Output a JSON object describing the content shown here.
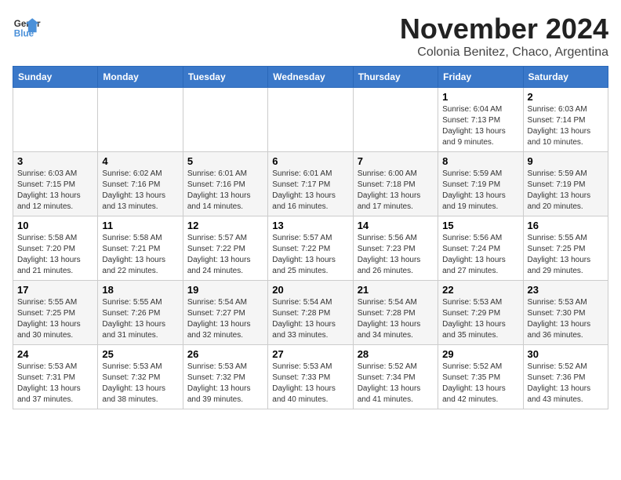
{
  "logo": {
    "line1": "General",
    "line2": "Blue"
  },
  "title": "November 2024",
  "location": "Colonia Benitez, Chaco, Argentina",
  "weekdays": [
    "Sunday",
    "Monday",
    "Tuesday",
    "Wednesday",
    "Thursday",
    "Friday",
    "Saturday"
  ],
  "weeks": [
    [
      {
        "day": "",
        "info": ""
      },
      {
        "day": "",
        "info": ""
      },
      {
        "day": "",
        "info": ""
      },
      {
        "day": "",
        "info": ""
      },
      {
        "day": "",
        "info": ""
      },
      {
        "day": "1",
        "info": "Sunrise: 6:04 AM\nSunset: 7:13 PM\nDaylight: 13 hours\nand 9 minutes."
      },
      {
        "day": "2",
        "info": "Sunrise: 6:03 AM\nSunset: 7:14 PM\nDaylight: 13 hours\nand 10 minutes."
      }
    ],
    [
      {
        "day": "3",
        "info": "Sunrise: 6:03 AM\nSunset: 7:15 PM\nDaylight: 13 hours\nand 12 minutes."
      },
      {
        "day": "4",
        "info": "Sunrise: 6:02 AM\nSunset: 7:16 PM\nDaylight: 13 hours\nand 13 minutes."
      },
      {
        "day": "5",
        "info": "Sunrise: 6:01 AM\nSunset: 7:16 PM\nDaylight: 13 hours\nand 14 minutes."
      },
      {
        "day": "6",
        "info": "Sunrise: 6:01 AM\nSunset: 7:17 PM\nDaylight: 13 hours\nand 16 minutes."
      },
      {
        "day": "7",
        "info": "Sunrise: 6:00 AM\nSunset: 7:18 PM\nDaylight: 13 hours\nand 17 minutes."
      },
      {
        "day": "8",
        "info": "Sunrise: 5:59 AM\nSunset: 7:19 PM\nDaylight: 13 hours\nand 19 minutes."
      },
      {
        "day": "9",
        "info": "Sunrise: 5:59 AM\nSunset: 7:19 PM\nDaylight: 13 hours\nand 20 minutes."
      }
    ],
    [
      {
        "day": "10",
        "info": "Sunrise: 5:58 AM\nSunset: 7:20 PM\nDaylight: 13 hours\nand 21 minutes."
      },
      {
        "day": "11",
        "info": "Sunrise: 5:58 AM\nSunset: 7:21 PM\nDaylight: 13 hours\nand 22 minutes."
      },
      {
        "day": "12",
        "info": "Sunrise: 5:57 AM\nSunset: 7:22 PM\nDaylight: 13 hours\nand 24 minutes."
      },
      {
        "day": "13",
        "info": "Sunrise: 5:57 AM\nSunset: 7:22 PM\nDaylight: 13 hours\nand 25 minutes."
      },
      {
        "day": "14",
        "info": "Sunrise: 5:56 AM\nSunset: 7:23 PM\nDaylight: 13 hours\nand 26 minutes."
      },
      {
        "day": "15",
        "info": "Sunrise: 5:56 AM\nSunset: 7:24 PM\nDaylight: 13 hours\nand 27 minutes."
      },
      {
        "day": "16",
        "info": "Sunrise: 5:55 AM\nSunset: 7:25 PM\nDaylight: 13 hours\nand 29 minutes."
      }
    ],
    [
      {
        "day": "17",
        "info": "Sunrise: 5:55 AM\nSunset: 7:25 PM\nDaylight: 13 hours\nand 30 minutes."
      },
      {
        "day": "18",
        "info": "Sunrise: 5:55 AM\nSunset: 7:26 PM\nDaylight: 13 hours\nand 31 minutes."
      },
      {
        "day": "19",
        "info": "Sunrise: 5:54 AM\nSunset: 7:27 PM\nDaylight: 13 hours\nand 32 minutes."
      },
      {
        "day": "20",
        "info": "Sunrise: 5:54 AM\nSunset: 7:28 PM\nDaylight: 13 hours\nand 33 minutes."
      },
      {
        "day": "21",
        "info": "Sunrise: 5:54 AM\nSunset: 7:28 PM\nDaylight: 13 hours\nand 34 minutes."
      },
      {
        "day": "22",
        "info": "Sunrise: 5:53 AM\nSunset: 7:29 PM\nDaylight: 13 hours\nand 35 minutes."
      },
      {
        "day": "23",
        "info": "Sunrise: 5:53 AM\nSunset: 7:30 PM\nDaylight: 13 hours\nand 36 minutes."
      }
    ],
    [
      {
        "day": "24",
        "info": "Sunrise: 5:53 AM\nSunset: 7:31 PM\nDaylight: 13 hours\nand 37 minutes."
      },
      {
        "day": "25",
        "info": "Sunrise: 5:53 AM\nSunset: 7:32 PM\nDaylight: 13 hours\nand 38 minutes."
      },
      {
        "day": "26",
        "info": "Sunrise: 5:53 AM\nSunset: 7:32 PM\nDaylight: 13 hours\nand 39 minutes."
      },
      {
        "day": "27",
        "info": "Sunrise: 5:53 AM\nSunset: 7:33 PM\nDaylight: 13 hours\nand 40 minutes."
      },
      {
        "day": "28",
        "info": "Sunrise: 5:52 AM\nSunset: 7:34 PM\nDaylight: 13 hours\nand 41 minutes."
      },
      {
        "day": "29",
        "info": "Sunrise: 5:52 AM\nSunset: 7:35 PM\nDaylight: 13 hours\nand 42 minutes."
      },
      {
        "day": "30",
        "info": "Sunrise: 5:52 AM\nSunset: 7:36 PM\nDaylight: 13 hours\nand 43 minutes."
      }
    ]
  ]
}
